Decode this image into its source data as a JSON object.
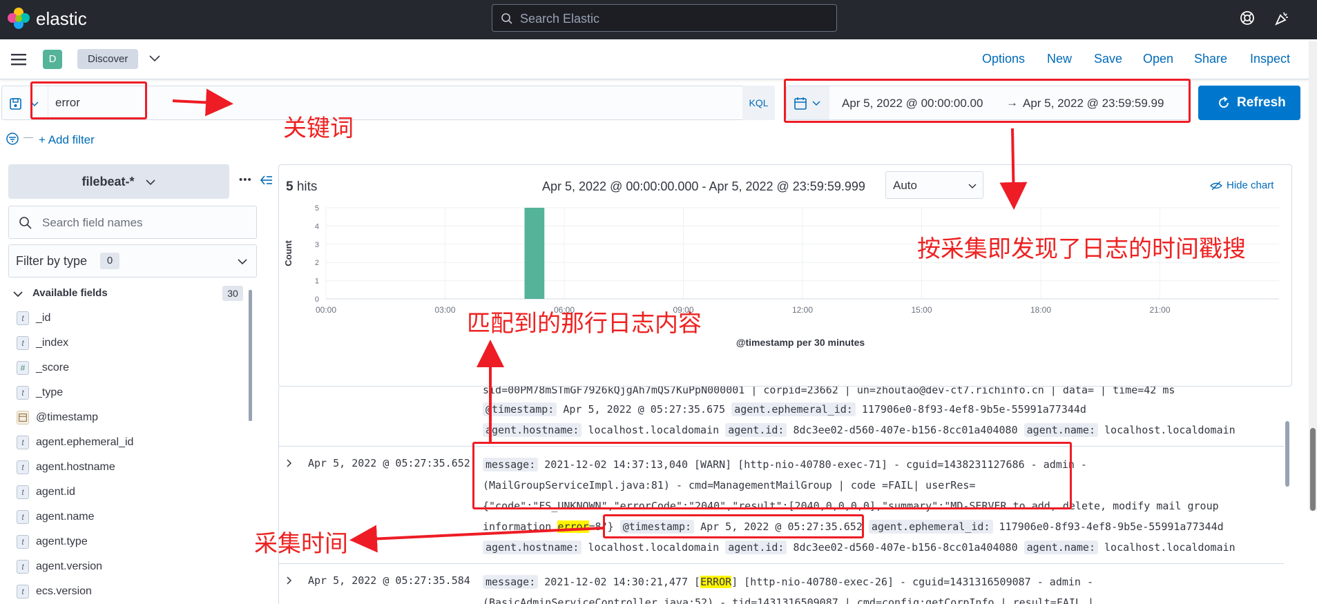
{
  "topbar": {
    "logo": "elastic",
    "search_placeholder": "Search Elastic"
  },
  "appbar": {
    "space_letter": "D",
    "app_name": "Discover",
    "links": [
      "Options",
      "New",
      "Save",
      "Open",
      "Share",
      "Inspect"
    ]
  },
  "query": {
    "value": "error",
    "language": "KQL"
  },
  "date_range": {
    "start": "Apr 5, 2022 @ 00:00:00.00",
    "end": "Apr 5, 2022 @ 23:59:59.99"
  },
  "refresh_label": "Refresh",
  "add_filter_label": "+ Add filter",
  "sidebar": {
    "index_pattern": "filebeat-*",
    "field_search_placeholder": "Search field names",
    "filter_by_type": "Filter by type",
    "filter_count": "0",
    "available_label": "Available fields",
    "available_count": "30",
    "fields": [
      {
        "type": "t",
        "name": "_id"
      },
      {
        "type": "t",
        "name": "_index"
      },
      {
        "type": "#",
        "name": "_score"
      },
      {
        "type": "t",
        "name": "_type"
      },
      {
        "type": "date",
        "name": "@timestamp"
      },
      {
        "type": "t",
        "name": "agent.ephemeral_id"
      },
      {
        "type": "t",
        "name": "agent.hostname"
      },
      {
        "type": "t",
        "name": "agent.id"
      },
      {
        "type": "t",
        "name": "agent.name"
      },
      {
        "type": "t",
        "name": "agent.type"
      },
      {
        "type": "t",
        "name": "agent.version"
      },
      {
        "type": "t",
        "name": "ecs.version"
      }
    ]
  },
  "chart_header": {
    "hits_count": "5",
    "hits_label": "hits",
    "range": "Apr 5, 2022 @ 00:00:00.000 - Apr 5, 2022 @ 23:59:59.999",
    "interval": "Auto",
    "hide_chart": "Hide chart"
  },
  "chart_data": {
    "type": "bar",
    "x_ticks": [
      "00:00",
      "03:00",
      "06:00",
      "09:00",
      "12:00",
      "15:00",
      "18:00",
      "21:00"
    ],
    "y_ticks": [
      "0",
      "1",
      "2",
      "3",
      "4",
      "5"
    ],
    "ylabel": "Count",
    "xlabel": "@timestamp per 30 minutes",
    "ylim": [
      0,
      5
    ],
    "xlim_hours": [
      0,
      24
    ],
    "bars": [
      {
        "x_start_hours": 5.0,
        "x_end_hours": 5.5,
        "value": 5
      }
    ],
    "color": "#54b399"
  },
  "docs": {
    "partial_row": {
      "line1": "sid=00PM78mSTmGF7926kQjgAh7mQS7KuPpN000001 | corpid=23662 | un=zhoutao@dev-ct7.richinfo.cn | data= | time=42 ms",
      "line2": [
        {
          "k": "@timestamp:",
          "v": "Apr 5, 2022 @ 05:27:35.675"
        },
        {
          "k": "agent.ephemeral_id:",
          "v": "117906e0-8f93-4ef8-9b5e-55991a77344d"
        }
      ],
      "line3": [
        {
          "k": "agent.hostname:",
          "v": "localhost.localdomain"
        },
        {
          "k": "agent.id:",
          "v": "8dc3ee02-d560-407e-b156-8cc01a404080"
        },
        {
          "k": "agent.name:",
          "v": "localhost.localdomain"
        }
      ]
    },
    "row2": {
      "time": "Apr 5, 2022 @ 05:27:35.652",
      "message_key": "message:",
      "l1": "2021-12-02 14:37:13,040 [WARN] [http-nio-40780-exec-71] - cguid=1438231127686 - admin -",
      "l2": "(MailGroupServiceImpl.java:81) - cmd=ManagementMailGroup | code =FAIL| userRes=",
      "l3": "{\"code\":\"FS_UNKNOWN\",\"errorCode\":\"2040\",\"result\":[2040,0,0,0,0],\"summary\":\"MD-SERVER to add, delete, modify mail group",
      "l4_pre": "information ",
      "l4_hl": "error",
      "l4_post": "=8\"}",
      "ts_key": "@timestamp:",
      "ts_val": "Apr 5, 2022 @ 05:27:35.652",
      "eph_key": "agent.ephemeral_id:",
      "eph_val": "117906e0-8f93-4ef8-9b5e-55991a77344d",
      "l5": [
        {
          "k": "agent.hostname:",
          "v": "localhost.localdomain"
        },
        {
          "k": "agent.id:",
          "v": "8dc3ee02-d560-407e-b156-8cc01a404080"
        },
        {
          "k": "agent.name:",
          "v": "localhost.localdomain"
        }
      ]
    },
    "row3": {
      "time": "Apr 5, 2022 @ 05:27:35.584",
      "message_key": "message:",
      "l1_pre": "2021-12-02 14:30:21,477 [",
      "l1_hl": "ERROR",
      "l1_post": "] [http-nio-40780-exec-26] - cguid=1431316509087 - admin -",
      "l2": "(BasicAdminServiceController.java:52) - tid=1431316509087 | cmd=config:getCorpInfo | result=FAIL |"
    }
  },
  "annotations": {
    "keyword": "关键词",
    "timestamp_search": "按采集即发现了日志的时间戳搜",
    "matched_line": "匹配到的那行日志内容",
    "collect_time": "采集时间"
  }
}
